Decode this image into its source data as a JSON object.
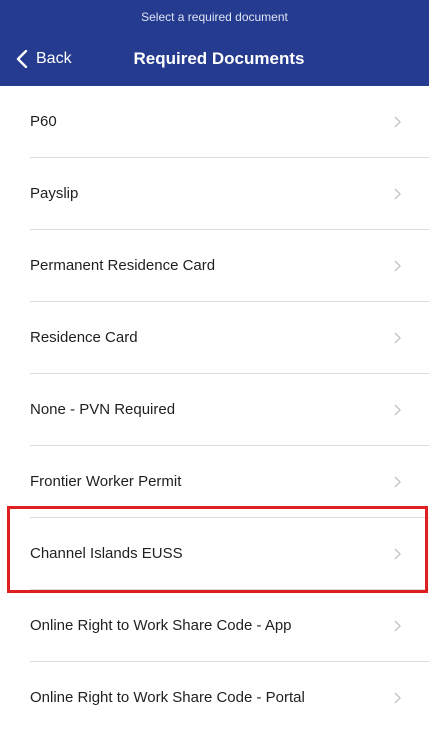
{
  "header": {
    "subtitle": "Select a required document",
    "back_label": "Back",
    "back_icon": "chevron-left-icon",
    "title": "Required Documents",
    "background_color": "#243b8f"
  },
  "documents": [
    {
      "label": "P60"
    },
    {
      "label": "Payslip"
    },
    {
      "label": "Permanent Residence Card"
    },
    {
      "label": "Residence Card"
    },
    {
      "label": "None - PVN Required"
    },
    {
      "label": "Frontier Worker Permit"
    },
    {
      "label": "Channel Islands EUSS",
      "highlighted": true
    },
    {
      "label": "Online Right to Work Share Code - App"
    },
    {
      "label": "Online Right to Work Share Code - Portal"
    }
  ],
  "row_icon": "chevron-right-icon",
  "highlight_color": "#e02020"
}
